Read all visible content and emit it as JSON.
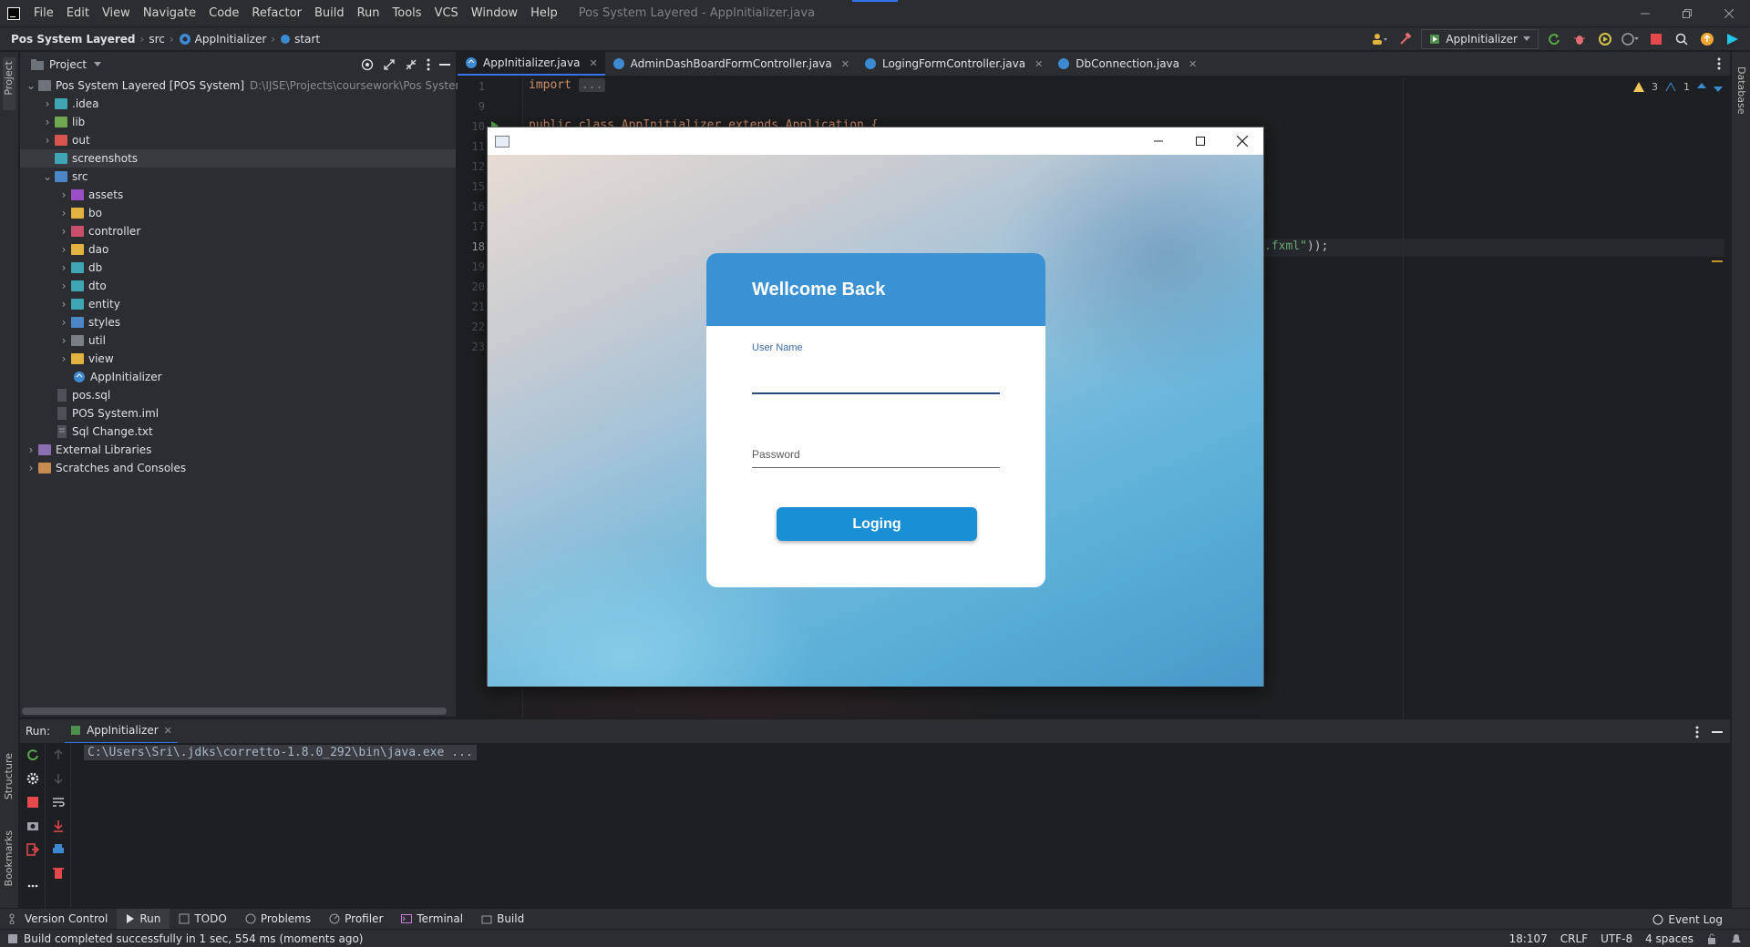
{
  "titlebar": {
    "menus": [
      "File",
      "Edit",
      "View",
      "Navigate",
      "Code",
      "Refactor",
      "Build",
      "Run",
      "Tools",
      "VCS",
      "Window",
      "Help"
    ],
    "title": "Pos System Layered - AppInitializer.java"
  },
  "navbar": {
    "project": "Pos System Layered",
    "crumb_src": "src",
    "crumb_class": "AppInitializer",
    "crumb_method": "start",
    "run_config": "AppInitializer"
  },
  "project_panel": {
    "title": "Project",
    "root_name": "Pos System Layered [POS System]",
    "root_path": "D:\\IJSE\\Projects\\coursework\\Pos System Layere",
    "items": [
      {
        "label": "idea",
        "display": ".idea"
      },
      {
        "label": "lib"
      },
      {
        "label": "out"
      },
      {
        "label": "screenshots"
      },
      {
        "label": "src"
      },
      {
        "label": "assets"
      },
      {
        "label": "bo"
      },
      {
        "label": "controller"
      },
      {
        "label": "dao"
      },
      {
        "label": "db"
      },
      {
        "label": "dto"
      },
      {
        "label": "entity"
      },
      {
        "label": "styles"
      },
      {
        "label": "util"
      },
      {
        "label": "view"
      },
      {
        "label": "AppInitializer"
      },
      {
        "label": "pos.sql"
      },
      {
        "label": "POS System.iml"
      },
      {
        "label": "Sql Change.txt"
      },
      {
        "label": "External Libraries"
      },
      {
        "label": "Scratches and Consoles"
      }
    ]
  },
  "editor": {
    "tabs": [
      "AppInitializer.java",
      "AdminDashBoardFormController.java",
      "LogingFormController.java",
      "DbConnection.java"
    ],
    "line_numbers": [
      "1",
      "9",
      "10",
      "11",
      "12",
      "15",
      "16",
      "17",
      "18",
      "19",
      "20",
      "21",
      "22",
      "23"
    ],
    "code_import": "import",
    "code_fold": "...",
    "code_line10": "public class AppInitializer extends Application {",
    "code_line18_str": ".fxml\"",
    "code_line18_end": "));",
    "warnings": "3",
    "typos": "1"
  },
  "login_window": {
    "heading": "Wellcome Back",
    "username_label": "User Name",
    "password_placeholder": "Password",
    "button": "Loging"
  },
  "run_panel": {
    "label": "Run:",
    "tab": "AppInitializer",
    "console": "C:\\Users\\Sri\\.jdks\\corretto-1.8.0_292\\bin\\java.exe ..."
  },
  "side_labels": {
    "project": "Project",
    "structure": "Structure",
    "bookmarks": "Bookmarks",
    "database": "Database"
  },
  "tool_tabs": [
    "Version Control",
    "Run",
    "TODO",
    "Problems",
    "Profiler",
    "Terminal",
    "Build"
  ],
  "event_log": "Event Log",
  "status": {
    "message": "Build completed successfully in 1 sec, 554 ms (moments ago)",
    "position": "18:107",
    "line_sep": "CRLF",
    "encoding": "UTF-8",
    "indent": "4 spaces"
  }
}
